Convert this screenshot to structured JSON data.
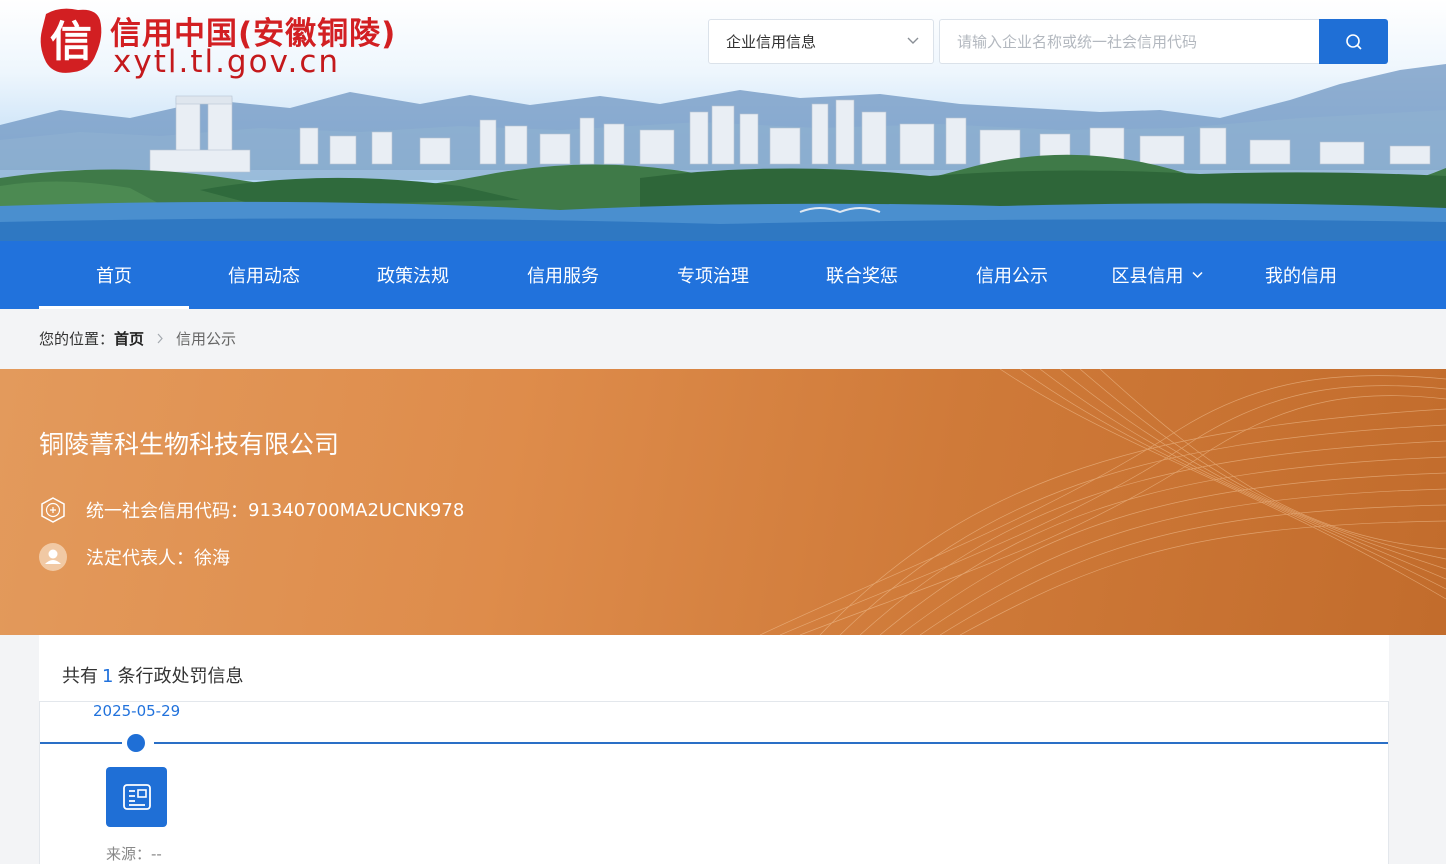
{
  "site": {
    "title": "信用中国(安徽铜陵)",
    "url": "xytl.tl.gov.cn",
    "logo_char": "信"
  },
  "search": {
    "type_selected": "企业信用信息",
    "placeholder": "请输入企业名称或统一社会信用代码",
    "button_icon": "search-icon"
  },
  "nav": {
    "items": [
      {
        "label": "首页",
        "active": true
      },
      {
        "label": "信用动态"
      },
      {
        "label": "政策法规"
      },
      {
        "label": "信用服务"
      },
      {
        "label": "专项治理"
      },
      {
        "label": "联合奖惩"
      },
      {
        "label": "信用公示"
      },
      {
        "label": "区县信用",
        "has_dropdown": true
      },
      {
        "label": "我的信用"
      }
    ]
  },
  "breadcrumb": {
    "prefix": "您的位置：",
    "home": "首页",
    "current": "信用公示"
  },
  "company": {
    "name": "铜陵菁科生物科技有限公司",
    "code_label": "统一社会信用代码：",
    "code_value": "91340700MA2UCNK978",
    "rep_label": "法定代表人：",
    "rep_value": "徐海"
  },
  "records": {
    "count_prefix": "共有",
    "count": "1",
    "count_suffix": "条行政处罚信息",
    "items": [
      {
        "date": "2025-05-29",
        "source_label": "来源：",
        "source_value": "--"
      }
    ]
  },
  "colors": {
    "primary": "#2172dc",
    "brand_red": "#d21f22",
    "company_banner": "#d9853f"
  }
}
